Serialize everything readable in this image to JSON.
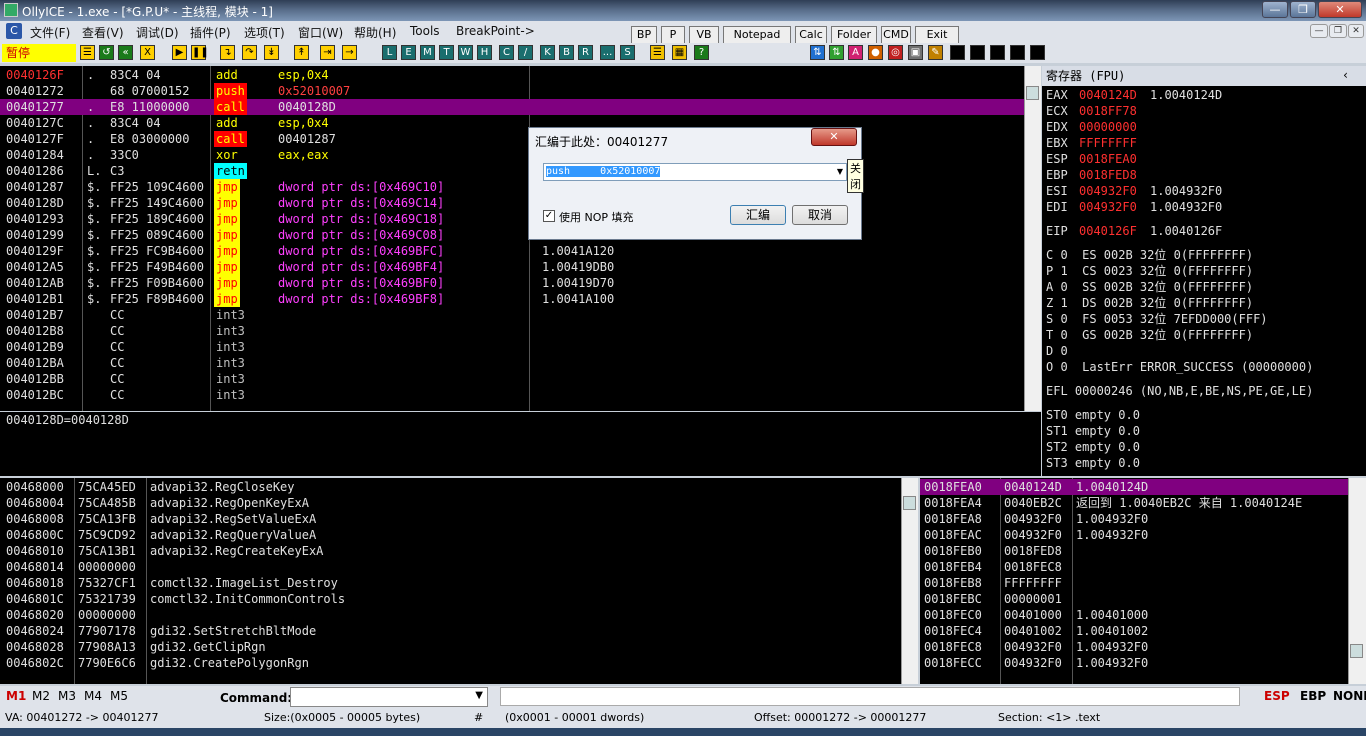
{
  "window": {
    "title": "OllyICE - 1.exe - [*G.P.U* -  主线程, 模块 - 1]"
  },
  "menu": [
    "文件(F)",
    "查看(V)",
    "调试(D)",
    "插件(P)",
    "选项(T)",
    "窗口(W)",
    "帮助(H)",
    "Tools",
    "BreakPoint->"
  ],
  "quick_buttons": [
    "BP",
    "P",
    "VB",
    "Notepad",
    "Calc",
    "Folder",
    "CMD",
    "Exit"
  ],
  "toolbar": {
    "status": "暂停",
    "letters": [
      "L",
      "E",
      "M",
      "T",
      "W",
      "H",
      "C",
      "/",
      "K",
      "B",
      "R",
      "...",
      "S"
    ]
  },
  "disasm": [
    {
      "addr": "0040126F",
      "m": ".",
      "hex": "83C4 04",
      "op": "add",
      "arg": "esp,0x4",
      "addr_red": true,
      "op_style": "y",
      "extra": ""
    },
    {
      "addr": "00401272",
      "m": "",
      "hex": "68 07000152",
      "op": "push",
      "arg": "0x52010007",
      "op_style": "r",
      "extra": ""
    },
    {
      "addr": "00401277",
      "m": ".",
      "hex": "E8 11000000",
      "op": "call",
      "arg": "0040128D",
      "op_style": "r",
      "hl": true,
      "extra": ""
    },
    {
      "addr": "0040127C",
      "m": ".",
      "hex": "83C4 04",
      "op": "add",
      "arg": "esp,0x4",
      "op_style": "y",
      "extra": ""
    },
    {
      "addr": "0040127F",
      "m": ".",
      "hex": "E8 03000000",
      "op": "call",
      "arg": "00401287",
      "op_style": "r",
      "extra": ""
    },
    {
      "addr": "00401284",
      "m": ".",
      "hex": "33C0",
      "op": "xor",
      "arg": "eax,eax",
      "op_style": "y",
      "extra": ""
    },
    {
      "addr": "00401286",
      "m": "L.",
      "hex": "C3",
      "op": "retn",
      "arg": "",
      "op_style": "c",
      "extra": ""
    },
    {
      "addr": "00401287",
      "m": "$.",
      "hex": "FF25 109C4600",
      "op": "jmp",
      "arg": "dword ptr ds:[0x469C10]",
      "op_style": "j",
      "extra": ""
    },
    {
      "addr": "0040128D",
      "m": "$.",
      "hex": "FF25 149C4600",
      "op": "jmp",
      "arg": "dword ptr ds:[0x469C14]",
      "op_style": "j",
      "extra": ""
    },
    {
      "addr": "00401293",
      "m": "$.",
      "hex": "FF25 189C4600",
      "op": "jmp",
      "arg": "dword ptr ds:[0x469C18]",
      "op_style": "j",
      "extra": ""
    },
    {
      "addr": "00401299",
      "m": "$.",
      "hex": "FF25 089C4600",
      "op": "jmp",
      "arg": "dword ptr ds:[0x469C08]",
      "op_style": "j",
      "extra": ""
    },
    {
      "addr": "0040129F",
      "m": "$.",
      "hex": "FF25 FC9B4600",
      "op": "jmp",
      "arg": "dword ptr ds:[0x469BFC]",
      "op_style": "j",
      "extra": "1.0041A120"
    },
    {
      "addr": "004012A5",
      "m": "$.",
      "hex": "FF25 F49B4600",
      "op": "jmp",
      "arg": "dword ptr ds:[0x469BF4]",
      "op_style": "j",
      "extra": "1.00419DB0"
    },
    {
      "addr": "004012AB",
      "m": "$.",
      "hex": "FF25 F09B4600",
      "op": "jmp",
      "arg": "dword ptr ds:[0x469BF0]",
      "op_style": "j",
      "extra": "1.00419D70"
    },
    {
      "addr": "004012B1",
      "m": "$.",
      "hex": "FF25 F89B4600",
      "op": "jmp",
      "arg": "dword ptr ds:[0x469BF8]",
      "op_style": "j",
      "extra": "1.0041A100"
    },
    {
      "addr": "004012B7",
      "m": "",
      "hex": "CC",
      "op": "int3",
      "arg": "",
      "op_style": "g",
      "extra": ""
    },
    {
      "addr": "004012B8",
      "m": "",
      "hex": "CC",
      "op": "int3",
      "arg": "",
      "op_style": "g",
      "extra": ""
    },
    {
      "addr": "004012B9",
      "m": "",
      "hex": "CC",
      "op": "int3",
      "arg": "",
      "op_style": "g",
      "extra": ""
    },
    {
      "addr": "004012BA",
      "m": "",
      "hex": "CC",
      "op": "int3",
      "arg": "",
      "op_style": "g",
      "extra": ""
    },
    {
      "addr": "004012BB",
      "m": "",
      "hex": "CC",
      "op": "int3",
      "arg": "",
      "op_style": "g",
      "extra": ""
    },
    {
      "addr": "004012BC",
      "m": "",
      "hex": "CC",
      "op": "int3",
      "arg": "",
      "op_style": "g",
      "extra": ""
    }
  ],
  "info_line": "0040128D=0040128D",
  "registers": {
    "title": "寄存器 (FPU)",
    "gp": [
      {
        "n": "EAX",
        "v": "0040124D",
        "x": "1.0040124D"
      },
      {
        "n": "ECX",
        "v": "0018FF78",
        "x": ""
      },
      {
        "n": "EDX",
        "v": "00000000",
        "x": ""
      },
      {
        "n": "EBX",
        "v": "FFFFFFFF",
        "x": ""
      },
      {
        "n": "ESP",
        "v": "0018FEA0",
        "x": ""
      },
      {
        "n": "EBP",
        "v": "0018FED8",
        "x": ""
      },
      {
        "n": "ESI",
        "v": "004932F0",
        "x": "1.004932F0"
      },
      {
        "n": "EDI",
        "v": "004932F0",
        "x": "1.004932F0"
      }
    ],
    "eip": {
      "n": "EIP",
      "v": "0040126F",
      "x": "1.0040126F"
    },
    "flags": [
      "C 0  ES 002B 32位 0(FFFFFFFF)",
      "P 1  CS 0023 32位 0(FFFFFFFF)",
      "A 0  SS 002B 32位 0(FFFFFFFF)",
      "Z 1  DS 002B 32位 0(FFFFFFFF)",
      "S 0  FS 0053 32位 7EFDD000(FFF)",
      "T 0  GS 002B 32位 0(FFFFFFFF)",
      "D 0",
      "O 0  LastErr ERROR_SUCCESS (00000000)"
    ],
    "efl": "EFL 00000246 (NO,NB,E,BE,NS,PE,GE,LE)",
    "fpu": [
      "ST0 empty 0.0",
      "ST1 empty 0.0",
      "ST2 empty 0.0",
      "ST3 empty 0.0"
    ]
  },
  "dump": [
    {
      "a": "00468000",
      "h": "75CA45ED",
      "t": "advapi32.RegCloseKey"
    },
    {
      "a": "00468004",
      "h": "75CA485B",
      "t": "advapi32.RegOpenKeyExA"
    },
    {
      "a": "00468008",
      "h": "75CA13FB",
      "t": "advapi32.RegSetValueExA"
    },
    {
      "a": "0046800C",
      "h": "75C9CD92",
      "t": "advapi32.RegQueryValueA"
    },
    {
      "a": "00468010",
      "h": "75CA13B1",
      "t": "advapi32.RegCreateKeyExA"
    },
    {
      "a": "00468014",
      "h": "00000000",
      "t": ""
    },
    {
      "a": "00468018",
      "h": "75327CF1",
      "t": "comctl32.ImageList_Destroy"
    },
    {
      "a": "0046801C",
      "h": "75321739",
      "t": "comctl32.InitCommonControls"
    },
    {
      "a": "00468020",
      "h": "00000000",
      "t": ""
    },
    {
      "a": "00468024",
      "h": "77907178",
      "t": "gdi32.SetStretchBltMode"
    },
    {
      "a": "00468028",
      "h": "77908A13",
      "t": "gdi32.GetClipRgn"
    },
    {
      "a": "0046802C",
      "h": "7790E6C6",
      "t": "gdi32.CreatePolygonRgn"
    }
  ],
  "stack": [
    {
      "a": "0018FEA0",
      "v": "0040124D",
      "t": "1.0040124D",
      "hl": true
    },
    {
      "a": "0018FEA4",
      "v": "0040EB2C",
      "t": "返回到 1.0040EB2C 来自 1.0040124E"
    },
    {
      "a": "0018FEA8",
      "v": "004932F0",
      "t": "1.004932F0"
    },
    {
      "a": "0018FEAC",
      "v": "004932F0",
      "t": "1.004932F0"
    },
    {
      "a": "0018FEB0",
      "v": "0018FED8",
      "t": ""
    },
    {
      "a": "0018FEB4",
      "v": "0018FEC8",
      "t": ""
    },
    {
      "a": "0018FEB8",
      "v": "FFFFFFFF",
      "t": ""
    },
    {
      "a": "0018FEBC",
      "v": "00000001",
      "t": ""
    },
    {
      "a": "0018FEC0",
      "v": "00401000",
      "t": "1.00401000"
    },
    {
      "a": "0018FEC4",
      "v": "00401002",
      "t": "1.00401002"
    },
    {
      "a": "0018FEC8",
      "v": "004932F0",
      "t": "1.004932F0"
    },
    {
      "a": "0018FECC",
      "v": "004932F0",
      "t": "1.004932F0"
    }
  ],
  "dialog": {
    "title": "汇编于此处：00401277",
    "input": "push     0x52010007",
    "nop_label": "使用 NOP 填充",
    "assemble": "汇编",
    "cancel": "取消",
    "tooltip": "关闭"
  },
  "command": {
    "mems": [
      "M1",
      "M2",
      "M3",
      "M4",
      "M5"
    ],
    "label": "Command:",
    "regs": [
      "ESP",
      "EBP",
      "NONE"
    ]
  },
  "status": {
    "va": "VA: 00401272 -> 00401277",
    "size": "Size:(0x0005 - 00005 bytes)",
    "hash": "#",
    "dwords": "(0x0001 - 00001 dwords)",
    "offset": "Offset: 00001272 -> 00001277",
    "section": "Section: <1> .text"
  }
}
